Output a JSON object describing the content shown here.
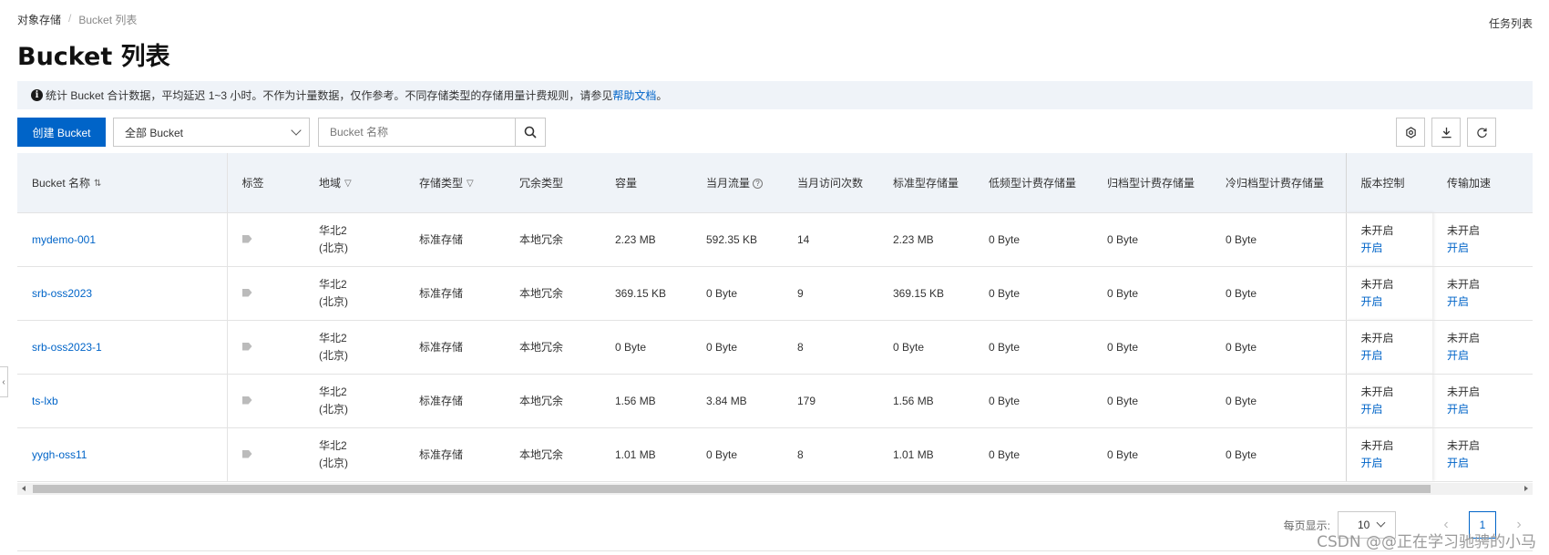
{
  "breadcrumb": {
    "root": "对象存储",
    "separator": "/",
    "current": "Bucket 列表"
  },
  "task_link": "任务列表",
  "page_title": "Bucket 列表",
  "notice": {
    "text": "统计 Bucket 合计数据，平均延迟 1~3 小时。不作为计量数据，仅作参考。不同存储类型的存储用量计费规则，请参见",
    "link": "帮助文档",
    "suffix": "。"
  },
  "toolbar": {
    "create_label": "创建 Bucket",
    "filter_selected": "全部 Bucket",
    "search_placeholder": "Bucket 名称"
  },
  "table": {
    "headers": [
      "Bucket 名称",
      "标签",
      "地域",
      "存储类型",
      "冗余类型",
      "容量",
      "当月流量",
      "当月访问次数",
      "标准型存储量",
      "低频型计费存储量",
      "归档型计费存储量",
      "冷归档型计费存储量",
      "版本控制",
      "传输加速"
    ],
    "rows": [
      {
        "name": "mydemo-001",
        "region1": "华北2",
        "region2": "(北京)",
        "storage": "标准存储",
        "redundancy": "本地冗余",
        "capacity": "2.23 MB",
        "traffic": "592.35 KB",
        "visits": "14",
        "standard": "2.23 MB",
        "ia": "0 Byte",
        "archive": "0 Byte",
        "cold": "0 Byte",
        "version_state": "未开启",
        "version_action": "开启",
        "accel_state": "未开启",
        "accel_action": "开启"
      },
      {
        "name": "srb-oss2023",
        "region1": "华北2",
        "region2": "(北京)",
        "storage": "标准存储",
        "redundancy": "本地冗余",
        "capacity": "369.15 KB",
        "traffic": "0 Byte",
        "visits": "9",
        "standard": "369.15 KB",
        "ia": "0 Byte",
        "archive": "0 Byte",
        "cold": "0 Byte",
        "version_state": "未开启",
        "version_action": "开启",
        "accel_state": "未开启",
        "accel_action": "开启"
      },
      {
        "name": "srb-oss2023-1",
        "region1": "华北2",
        "region2": "(北京)",
        "storage": "标准存储",
        "redundancy": "本地冗余",
        "capacity": "0 Byte",
        "traffic": "0 Byte",
        "visits": "8",
        "standard": "0 Byte",
        "ia": "0 Byte",
        "archive": "0 Byte",
        "cold": "0 Byte",
        "version_state": "未开启",
        "version_action": "开启",
        "accel_state": "未开启",
        "accel_action": "开启"
      },
      {
        "name": "ts-lxb",
        "region1": "华北2",
        "region2": "(北京)",
        "storage": "标准存储",
        "redundancy": "本地冗余",
        "capacity": "1.56 MB",
        "traffic": "3.84 MB",
        "visits": "179",
        "standard": "1.56 MB",
        "ia": "0 Byte",
        "archive": "0 Byte",
        "cold": "0 Byte",
        "version_state": "未开启",
        "version_action": "开启",
        "accel_state": "未开启",
        "accel_action": "开启"
      },
      {
        "name": "yygh-oss11",
        "region1": "华北2",
        "region2": "(北京)",
        "storage": "标准存储",
        "redundancy": "本地冗余",
        "capacity": "1.01 MB",
        "traffic": "0 Byte",
        "visits": "8",
        "standard": "1.01 MB",
        "ia": "0 Byte",
        "archive": "0 Byte",
        "cold": "0 Byte",
        "version_state": "未开启",
        "version_action": "开启",
        "accel_state": "未开启",
        "accel_action": "开启"
      }
    ]
  },
  "pager": {
    "label": "每页显示:",
    "page_size": "10",
    "current_page": "1"
  },
  "watermark": "CSDN @@正在学习驰骋的小马",
  "colors": {
    "primary": "#0064c8",
    "header_bg": "#eff3f8"
  }
}
